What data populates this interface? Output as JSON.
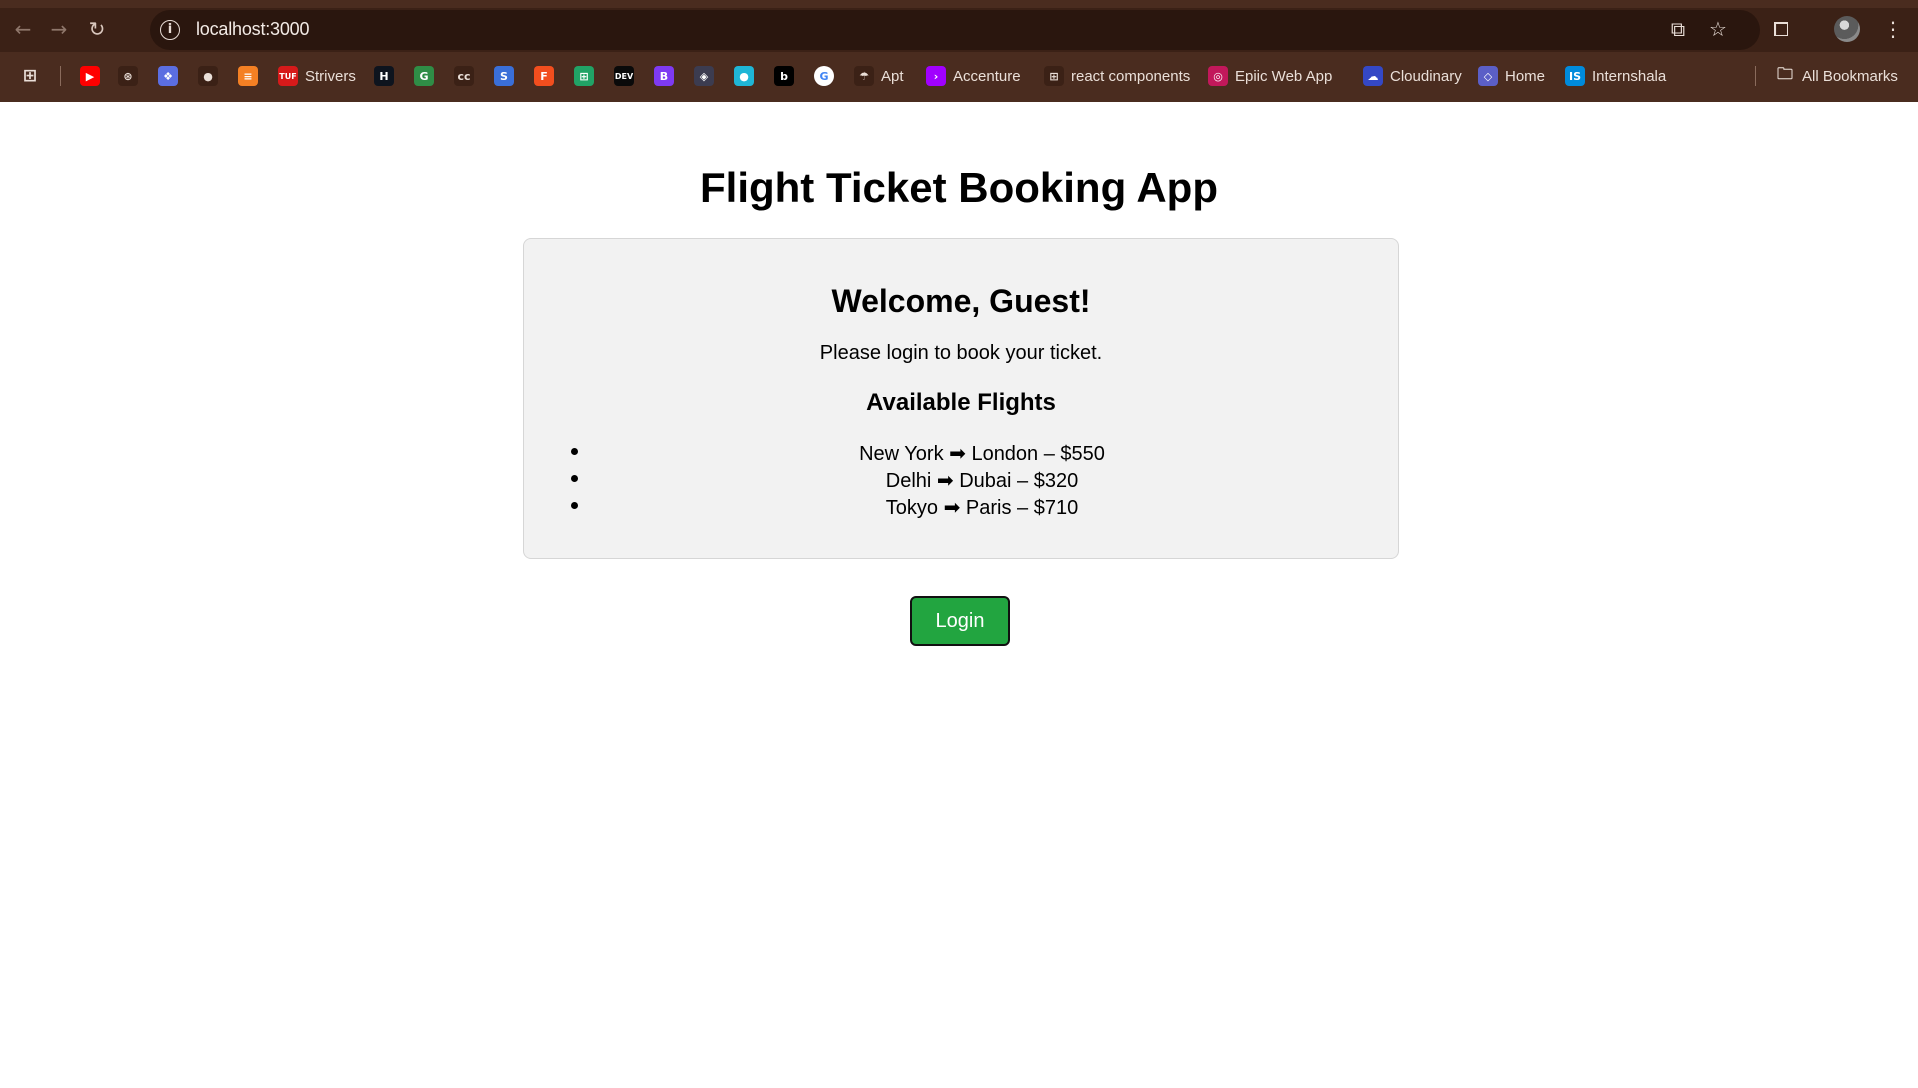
{
  "browser": {
    "url": "localhost:3000",
    "bookmarks": [
      {
        "label": "",
        "icon": "youtube-icon",
        "color": "#ff0000",
        "glyph": "▶"
      },
      {
        "label": "",
        "icon": "chatgpt-icon",
        "color": "#3b2116",
        "glyph": "⊛"
      },
      {
        "label": "",
        "icon": "bird-icon",
        "color": "#5b6ee1",
        "glyph": "❖"
      },
      {
        "label": "",
        "icon": "github-icon",
        "color": "#3b2116",
        "glyph": "●"
      },
      {
        "label": "",
        "icon": "stackoverflow-icon",
        "color": "#f48024",
        "glyph": "≡"
      },
      {
        "label": "Strivers",
        "icon": "tuf-icon",
        "color": "#d61a1a",
        "glyph": "TUF"
      },
      {
        "label": "",
        "icon": "hackerrank-icon",
        "color": "#0e141e",
        "glyph": "H"
      },
      {
        "label": "",
        "icon": "geeksforgeeks-icon",
        "color": "#2f8d46",
        "glyph": "G"
      },
      {
        "label": "",
        "icon": "codechef-icon",
        "color": "#3b2116",
        "glyph": "cc"
      },
      {
        "label": "",
        "icon": "coding-ninjas-icon",
        "color": "#3a6fd8",
        "glyph": "S"
      },
      {
        "label": "",
        "icon": "figma-icon",
        "color": "#f24e1e",
        "glyph": "F"
      },
      {
        "label": "",
        "icon": "sheets-icon",
        "color": "#21a366",
        "glyph": "⊞"
      },
      {
        "label": "",
        "icon": "dev-icon",
        "color": "#0a0a0a",
        "glyph": "DEV"
      },
      {
        "label": "",
        "icon": "bootstrap-icon",
        "color": "#7e3af2",
        "glyph": "B"
      },
      {
        "label": "",
        "icon": "app-icon",
        "color": "#3c3c50",
        "glyph": "◈"
      },
      {
        "label": "",
        "icon": "circle-gradient-icon",
        "color": "#1fb6d6",
        "glyph": "●"
      },
      {
        "label": "",
        "icon": "bold-b-icon",
        "color": "#000000",
        "glyph": "b"
      },
      {
        "label": "",
        "icon": "google-icon",
        "color": "#ffffff",
        "glyph": "G"
      },
      {
        "label": "Apt",
        "icon": "apt-icon",
        "color": "#3b2116",
        "glyph": "☂"
      },
      {
        "label": "Accenture",
        "icon": "accenture-icon",
        "color": "#a100ff",
        "glyph": "›"
      },
      {
        "label": "react components",
        "icon": "react-components-icon",
        "color": "#3b2116",
        "glyph": "⊞"
      },
      {
        "label": "Epiic Web App",
        "icon": "epiic-icon",
        "color": "#c2185b",
        "glyph": "◎"
      },
      {
        "label": "Cloudinary",
        "icon": "cloudinary-icon",
        "color": "#3448c5",
        "glyph": "☁"
      },
      {
        "label": "Home",
        "icon": "home-icon",
        "color": "#5b5fc7",
        "glyph": "◇"
      },
      {
        "label": "Internshala",
        "icon": "internshala-icon",
        "color": "#008bdc",
        "glyph": "IS"
      }
    ],
    "all_bookmarks_label": "All Bookmarks"
  },
  "app": {
    "title": "Flight Ticket Booking App",
    "welcome": "Welcome, Guest!",
    "prompt": "Please login to book your ticket.",
    "flights_title": "Available Flights",
    "flights": [
      "New York ➡ London – $550",
      "Delhi ➡ Dubai – $320",
      "Tokyo ➡ Paris – $710"
    ],
    "login_label": "Login",
    "colors": {
      "login_button": "#22a540",
      "card_background": "#f2f2f2"
    }
  }
}
